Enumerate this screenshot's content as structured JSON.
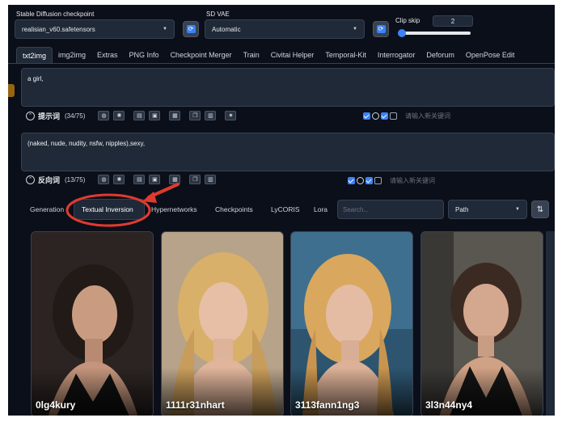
{
  "header": {
    "checkpoint_label": "Stable Diffusion checkpoint",
    "checkpoint_value": "realisian_v60.safetensors",
    "vae_label": "SD VAE",
    "vae_value": "Automatic",
    "clip_label": "Clip skip",
    "clip_value": "2",
    "clip_level": 0.05
  },
  "tabs": [
    "txt2img",
    "img2img",
    "Extras",
    "PNG Info",
    "Checkpoint Merger",
    "Train",
    "Civitai Helper",
    "Temporal-Kit",
    "Interrogator",
    "Deforum",
    "OpenPose Edit"
  ],
  "positive": {
    "text": "a girl,",
    "label": "提示词",
    "count": "(34/75)",
    "keyword_placeholder": "请输入新关键词"
  },
  "negative": {
    "text": "(naked, nude, nudity, nsfw, nipples),sexy,",
    "label": "反向词",
    "count": "(13/75)",
    "keyword_placeholder": "请输入新关键词"
  },
  "extra_tabs": [
    "Generation",
    "Textual Inversion",
    "Hypernetworks",
    "Checkpoints",
    "LyCORIS",
    "Lora"
  ],
  "search_placeholder": "Search...",
  "sort_value": "Path",
  "cards": [
    "0lg4kury",
    "1111r31nhart",
    "3113fann1ng3",
    "3l3n44ny4"
  ],
  "annotation_color": "#e03a2f",
  "accent": "#3b82f6"
}
